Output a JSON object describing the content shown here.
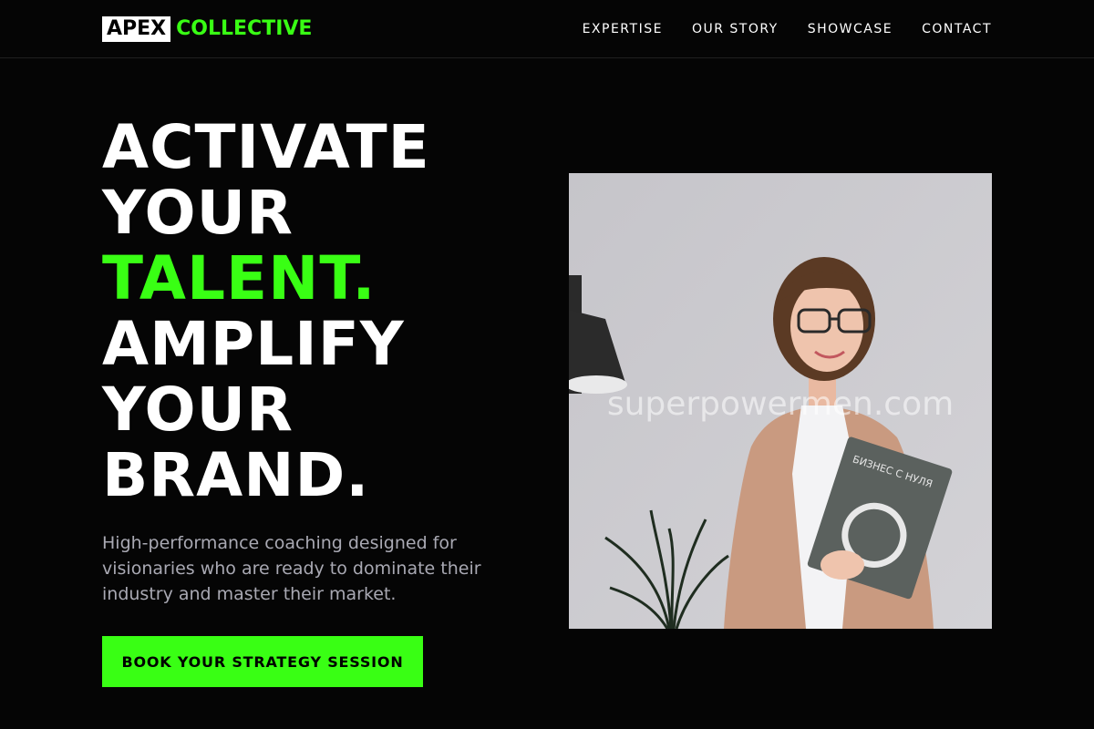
{
  "brand": {
    "name_boxed": "APEX",
    "name_accent": "COLLECTIVE"
  },
  "nav": {
    "items": [
      {
        "label": "EXPERTISE"
      },
      {
        "label": "OUR STORY"
      },
      {
        "label": "SHOWCASE"
      },
      {
        "label": "CONTACT"
      }
    ]
  },
  "hero": {
    "title_lines": [
      "ACTIVATE",
      "YOUR",
      "TALENT.",
      "AMPLIFY",
      "YOUR",
      "BRAND."
    ],
    "subtitle": "High-performance coaching designed for visionaries who are ready to dominate their industry and master their market.",
    "cta_label": "BOOK YOUR STRATEGY SESSION",
    "image": {
      "watermark": "superpowermen.com",
      "book_title": "БИЗНЕС С НУЛЯ"
    }
  },
  "colors": {
    "background": "#050505",
    "accent": "#39ff14",
    "text": "#ffffff",
    "muted": "#a9a9b3"
  }
}
